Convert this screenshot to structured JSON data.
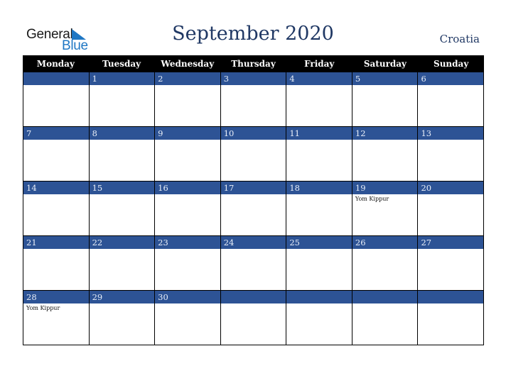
{
  "logo": {
    "word1": "General",
    "word2": "Blue",
    "icon": "triangle-flag-icon"
  },
  "title": "September 2020",
  "country": "Croatia",
  "colors": {
    "header_bg": "#000000",
    "day_bar": "#2d5395",
    "title": "#203864",
    "logo_blue": "#1f77c4"
  },
  "weekdays": [
    "Monday",
    "Tuesday",
    "Wednesday",
    "Thursday",
    "Friday",
    "Saturday",
    "Sunday"
  ],
  "weeks": [
    [
      {
        "day": "",
        "event": ""
      },
      {
        "day": "1",
        "event": ""
      },
      {
        "day": "2",
        "event": ""
      },
      {
        "day": "3",
        "event": ""
      },
      {
        "day": "4",
        "event": ""
      },
      {
        "day": "5",
        "event": ""
      },
      {
        "day": "6",
        "event": ""
      }
    ],
    [
      {
        "day": "7",
        "event": ""
      },
      {
        "day": "8",
        "event": ""
      },
      {
        "day": "9",
        "event": ""
      },
      {
        "day": "10",
        "event": ""
      },
      {
        "day": "11",
        "event": ""
      },
      {
        "day": "12",
        "event": ""
      },
      {
        "day": "13",
        "event": ""
      }
    ],
    [
      {
        "day": "14",
        "event": ""
      },
      {
        "day": "15",
        "event": ""
      },
      {
        "day": "16",
        "event": ""
      },
      {
        "day": "17",
        "event": ""
      },
      {
        "day": "18",
        "event": ""
      },
      {
        "day": "19",
        "event": "Yom Kippur"
      },
      {
        "day": "20",
        "event": ""
      }
    ],
    [
      {
        "day": "21",
        "event": ""
      },
      {
        "day": "22",
        "event": ""
      },
      {
        "day": "23",
        "event": ""
      },
      {
        "day": "24",
        "event": ""
      },
      {
        "day": "25",
        "event": ""
      },
      {
        "day": "26",
        "event": ""
      },
      {
        "day": "27",
        "event": ""
      }
    ],
    [
      {
        "day": "28",
        "event": "Yom Kippur"
      },
      {
        "day": "29",
        "event": ""
      },
      {
        "day": "30",
        "event": ""
      },
      {
        "day": "",
        "event": ""
      },
      {
        "day": "",
        "event": ""
      },
      {
        "day": "",
        "event": ""
      },
      {
        "day": "",
        "event": ""
      }
    ]
  ]
}
